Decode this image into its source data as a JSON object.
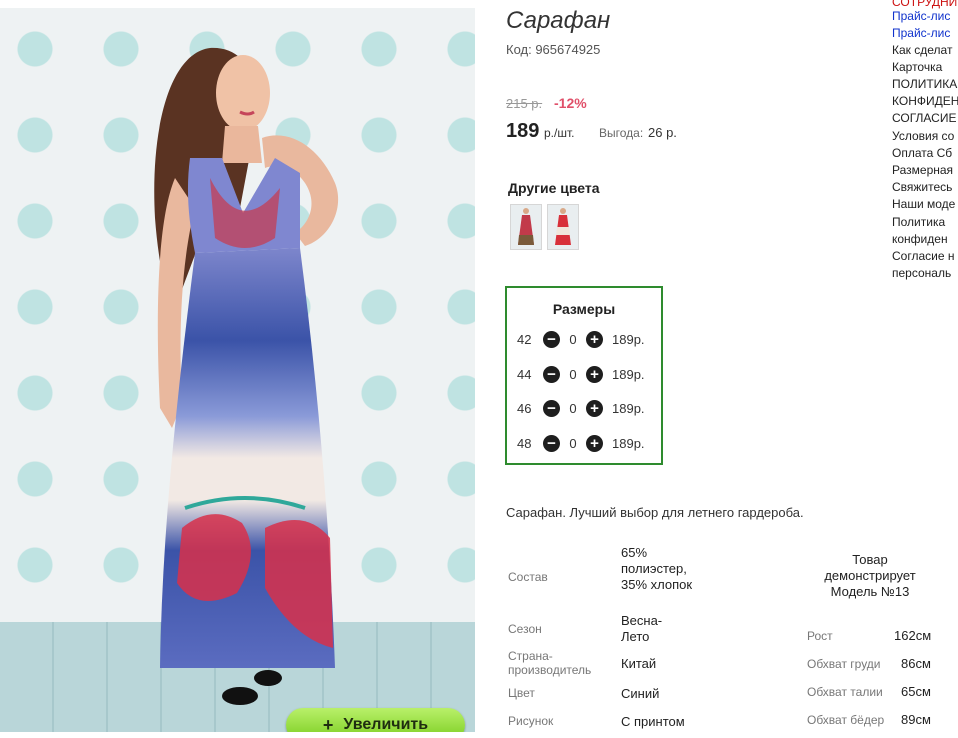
{
  "product": {
    "title": "Сарафан",
    "code": "Код: 965674925",
    "old_price": "215 р.",
    "discount": "-12%",
    "price": "189",
    "price_unit": "р./шт.",
    "savings_label": "Выгода:",
    "savings_value": "26 р.",
    "zoom_button": "Увеличить"
  },
  "other_colors": {
    "title": "Другие цвета",
    "thumbs": [
      {
        "colors": [
          "#c23a4a",
          "#7a5a3a"
        ]
      },
      {
        "colors": [
          "#d8303a",
          "#f0e6dc"
        ]
      }
    ]
  },
  "sizes": {
    "title": "Размеры",
    "rows": [
      {
        "size": "42",
        "qty": "0",
        "price": "189р."
      },
      {
        "size": "44",
        "qty": "0",
        "price": "189р."
      },
      {
        "size": "46",
        "qty": "0",
        "price": "189р."
      },
      {
        "size": "48",
        "qty": "0",
        "price": "189р."
      }
    ]
  },
  "description": "Сарафан. Лучший выбор для летнего гардероба.",
  "specs": [
    {
      "label": "Состав",
      "value": "65% полиэстер, 35% хлопок"
    },
    {
      "label": "Сезон",
      "value": "Весна-Лето"
    },
    {
      "label": "Страна-производитель",
      "value": "Китай"
    },
    {
      "label": "Цвет",
      "value": "Синий"
    },
    {
      "label": "Рисунок",
      "value": "С принтом"
    }
  ],
  "model": {
    "title": "Товар демонстрирует Модель №13",
    "measurements": [
      {
        "label": "Рост",
        "value": "162см"
      },
      {
        "label": "Обхват груди",
        "value": "86см"
      },
      {
        "label": "Обхват талии",
        "value": "65см"
      },
      {
        "label": "Обхват бёдер",
        "value": "89см"
      }
    ]
  },
  "sidebar_links": [
    {
      "text": "СОТРУДНИ",
      "color": "red"
    },
    {
      "text": "Прайс-лис",
      "color": "blue"
    },
    {
      "text": "Прайс-лис",
      "color": "blue"
    },
    {
      "text": "Как сделат",
      "color": "default"
    },
    {
      "text": "Карточка",
      "color": "default"
    },
    {
      "text": "ПОЛИТИКА",
      "color": "default"
    },
    {
      "text": "КОНФИДЕН",
      "color": "default"
    },
    {
      "text": "СОГЛАСИЕ",
      "color": "default"
    },
    {
      "text": "Условия со",
      "color": "default"
    },
    {
      "text": "Оплата Сб",
      "color": "default"
    },
    {
      "text": "Размерная",
      "color": "default"
    },
    {
      "text": "Свяжитесь",
      "color": "default"
    },
    {
      "text": "Наши моде",
      "color": "default"
    },
    {
      "text": "Политика",
      "color": "default"
    },
    {
      "text": "конфиден",
      "color": "default"
    },
    {
      "text": "Согласие н",
      "color": "default"
    },
    {
      "text": "персональ",
      "color": "default"
    }
  ],
  "colors": {
    "accent_green": "#2e8b2e",
    "discount_pink": "#e0506a",
    "link_blue": "#1133cc",
    "button_green": "#8fdc32"
  }
}
